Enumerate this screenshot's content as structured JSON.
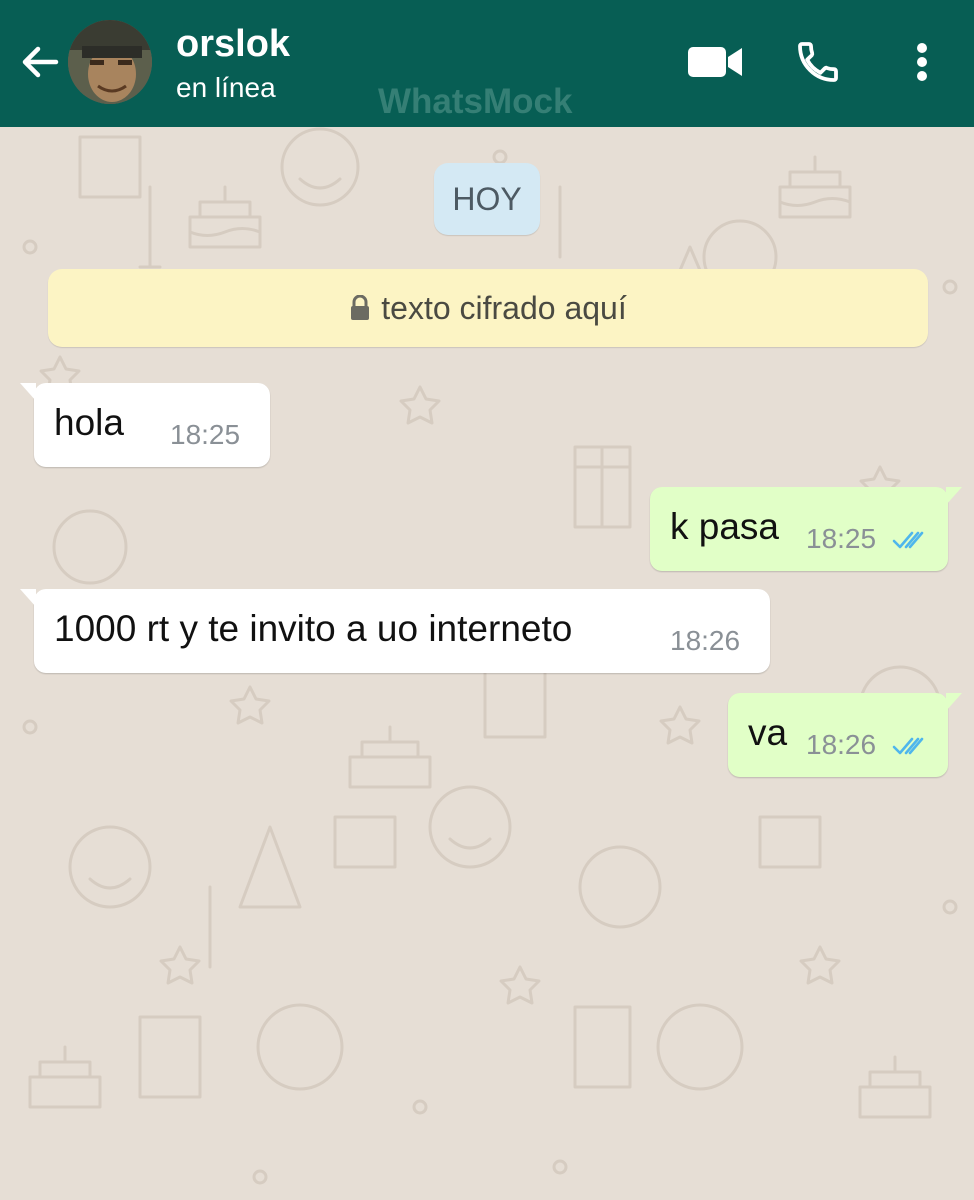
{
  "header": {
    "contact_name": "orslok",
    "contact_status": "en línea",
    "watermark": "WhatsMock",
    "back_icon": "arrow-left-icon",
    "video_icon": "video-camera-icon",
    "call_icon": "phone-icon",
    "menu_icon": "more-vertical-icon",
    "background_color": "#075e54"
  },
  "chat": {
    "date_chip": "HOY",
    "encryption_notice": "texto cifrado aquí",
    "messages": [
      {
        "direction": "in",
        "text": "hola",
        "time": "18:25"
      },
      {
        "direction": "out",
        "text": "k pasa",
        "time": "18:25",
        "status": "read"
      },
      {
        "direction": "in",
        "text": "1000 rt y te invito a uo interneto",
        "time": "18:26"
      },
      {
        "direction": "out",
        "text": "va",
        "time": "18:26",
        "status": "read"
      }
    ],
    "colors": {
      "wallpaper": "#e6ded5",
      "incoming_bubble": "#ffffff",
      "outgoing_bubble": "#e1ffc7",
      "read_ticks": "#4fb6ec"
    }
  }
}
